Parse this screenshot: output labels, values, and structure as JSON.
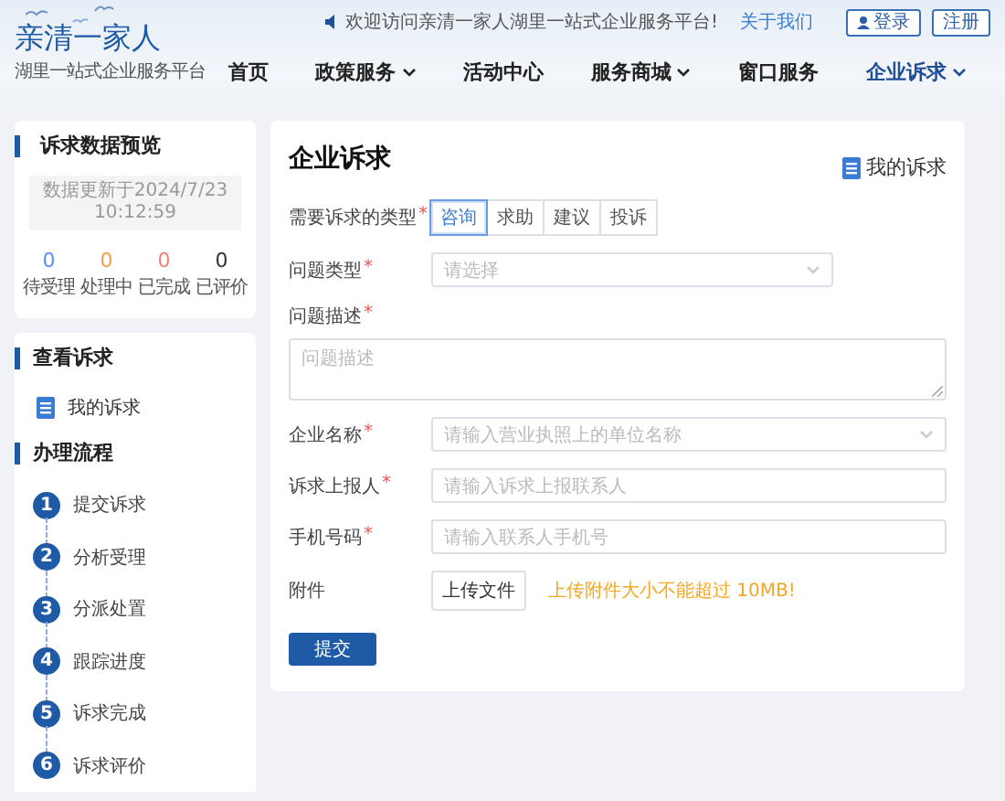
{
  "header": {
    "logo_title": "亲清一家人",
    "logo_subtitle": "湖里一站式企业服务平台",
    "welcome": "欢迎访问亲清一家人湖里一站式企业服务平台!",
    "about_link": "关于我们",
    "login_button": "登录",
    "register_button": "注册",
    "nav": [
      {
        "label": "首页",
        "dropdown": false,
        "selected": false
      },
      {
        "label": "政策服务",
        "dropdown": true,
        "selected": false
      },
      {
        "label": "活动中心",
        "dropdown": false,
        "selected": false
      },
      {
        "label": "服务商城",
        "dropdown": true,
        "selected": false
      },
      {
        "label": "窗口服务",
        "dropdown": false,
        "selected": false
      },
      {
        "label": "企业诉求",
        "dropdown": true,
        "selected": true
      }
    ]
  },
  "sidebar": {
    "preview": {
      "title": "诉求数据预览",
      "updated": "数据更新于2024/7/23 10:12:59",
      "stats": [
        {
          "value": "0",
          "label": "待受理",
          "color": "#5b8ff9"
        },
        {
          "value": "0",
          "label": "处理中",
          "color": "#f5a04a"
        },
        {
          "value": "0",
          "label": "已完成",
          "color": "#f08080"
        },
        {
          "value": "0",
          "label": "已评价",
          "color": "#333333"
        }
      ]
    },
    "view": {
      "title": "查看诉求",
      "items": [
        {
          "label": "我的诉求"
        }
      ]
    },
    "process": {
      "title": "办理流程",
      "steps": [
        {
          "number": "1",
          "label": "提交诉求"
        },
        {
          "number": "2",
          "label": "分析受理"
        },
        {
          "number": "3",
          "label": "分派处置"
        },
        {
          "number": "4",
          "label": "跟踪进度"
        },
        {
          "number": "5",
          "label": "诉求完成"
        },
        {
          "number": "6",
          "label": "诉求评价"
        }
      ]
    }
  },
  "main": {
    "title": "企业诉求",
    "my_appeals_link": "我的诉求",
    "type_field": {
      "label": "需要诉求的类型",
      "required_mark": "*",
      "options": [
        {
          "label": "咨询",
          "selected": true
        },
        {
          "label": "求助",
          "selected": false
        },
        {
          "label": "建议",
          "selected": false
        },
        {
          "label": "投诉",
          "selected": false
        }
      ]
    },
    "fields": [
      {
        "kind": "select",
        "label": "问题类型",
        "required_mark": "*",
        "placeholder": "请选择"
      },
      {
        "kind": "textarea",
        "label": "问题描述",
        "required_mark": "*",
        "placeholder": "问题描述"
      },
      {
        "kind": "select",
        "label": "企业名称",
        "required_mark": "*",
        "placeholder": "请输入营业执照上的单位名称"
      },
      {
        "kind": "input",
        "label": "诉求上报人",
        "required_mark": "*",
        "placeholder": "请输入诉求上报联系人"
      },
      {
        "kind": "input",
        "label": "手机号码",
        "required_mark": "*",
        "placeholder": "请输入联系人手机号"
      },
      {
        "kind": "upload",
        "label": "附件",
        "button": "上传文件",
        "hint": "上传附件大小不能超过 10MB!"
      }
    ],
    "submit_button": "提交"
  }
}
